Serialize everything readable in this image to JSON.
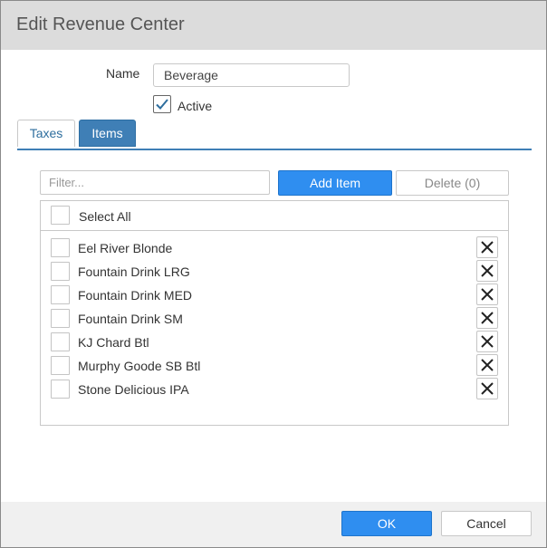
{
  "dialog": {
    "title": "Edit Revenue Center",
    "name_label": "Name",
    "name_value": "Beverage",
    "active_label": "Active",
    "active_checked": true
  },
  "tabs": [
    {
      "label": "Taxes",
      "selected": false
    },
    {
      "label": "Items",
      "selected": true
    }
  ],
  "items_panel": {
    "filter_placeholder": "Filter...",
    "add_item_label": "Add Item",
    "delete_label": "Delete (0)",
    "select_all_label": "Select All",
    "items": [
      {
        "label": "Eel River Blonde"
      },
      {
        "label": "Fountain Drink LRG"
      },
      {
        "label": "Fountain Drink MED"
      },
      {
        "label": "Fountain Drink SM"
      },
      {
        "label": "KJ Chard Btl"
      },
      {
        "label": "Murphy Goode SB Btl"
      },
      {
        "label": "Stone Delicious IPA"
      }
    ]
  },
  "footer": {
    "ok_label": "OK",
    "cancel_label": "Cancel"
  },
  "colors": {
    "primary": "#2f8ef0",
    "tab_active": "#3f7fb6",
    "titlebar": "#dcdcdc"
  },
  "icons": {
    "active_check": "checkmark-icon",
    "remove": "close-x-icon"
  }
}
